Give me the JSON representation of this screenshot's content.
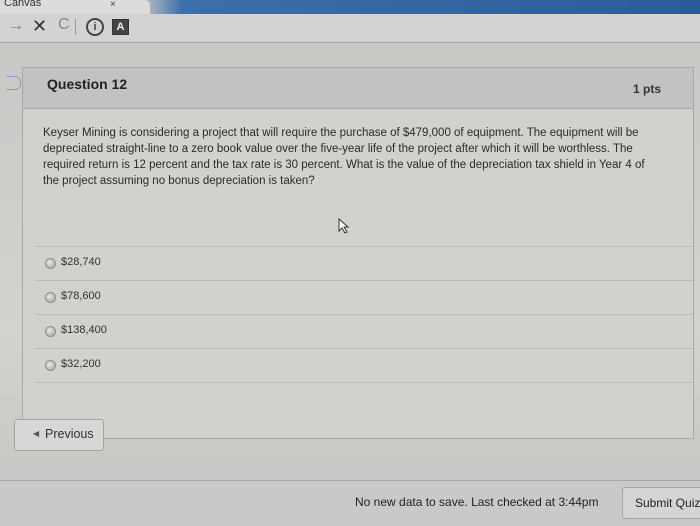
{
  "browser": {
    "tab_title": "Canvas",
    "tab_close": "×",
    "forward_icon": "→",
    "stop_icon": "✕",
    "reload_icon": "C",
    "info_icon": "i",
    "ext_icon": "A"
  },
  "question": {
    "title": "Question 12",
    "points": "1 pts",
    "text": "Keyser Mining is considering a project that will require the purchase of $479,000 of equipment. The equipment will be depreciated straight-line to a zero book value over the five-year life of the project after which it will be worthless. The required return is 12 percent and the tax rate is 30 percent. What is the value of the depreciation tax shield in Year 4 of the project assuming no bonus depreciation is taken?",
    "answers": [
      {
        "label": "$28,740"
      },
      {
        "label": "$78,600"
      },
      {
        "label": "$138,400"
      },
      {
        "label": "$32,200"
      }
    ]
  },
  "navigation": {
    "previous_label": "Previous",
    "previous_icon": "◀"
  },
  "footer": {
    "status": "No new data to save. Last checked at 3:44pm",
    "submit_label": "Submit Quiz"
  },
  "colors": {
    "page_bg": "#d1d2ce",
    "text": "#2b2b2b",
    "tab_accent": "#2a5c98"
  }
}
